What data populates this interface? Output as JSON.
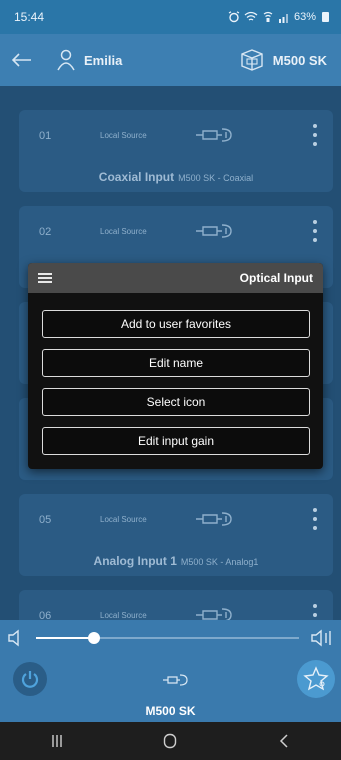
{
  "status_bar": {
    "time": "15:44",
    "battery": "63%"
  },
  "app_bar": {
    "user_name": "Emilia",
    "device_name": "M500 SK"
  },
  "cards": [
    {
      "number": "01",
      "source": "Local Source",
      "name": "Coaxial Input",
      "subtitle": "M500 SK - Coaxial"
    },
    {
      "number": "02",
      "source": "Local Source"
    },
    {
      "number": "05",
      "source": "Local Source",
      "name": "Analog Input 1",
      "subtitle": "M500 SK - Analog1"
    },
    {
      "number": "06",
      "source": "Local Source"
    }
  ],
  "popup": {
    "title": "Optical Input",
    "options": [
      "Add to user favorites",
      "Edit name",
      "Select icon",
      "Edit input gain"
    ]
  },
  "player": {
    "device_name": "M500 SK",
    "volume_fraction": 0.22
  },
  "colors": {
    "accent": "#3d7fb2",
    "background": "#234f74",
    "popup": "#111111"
  }
}
